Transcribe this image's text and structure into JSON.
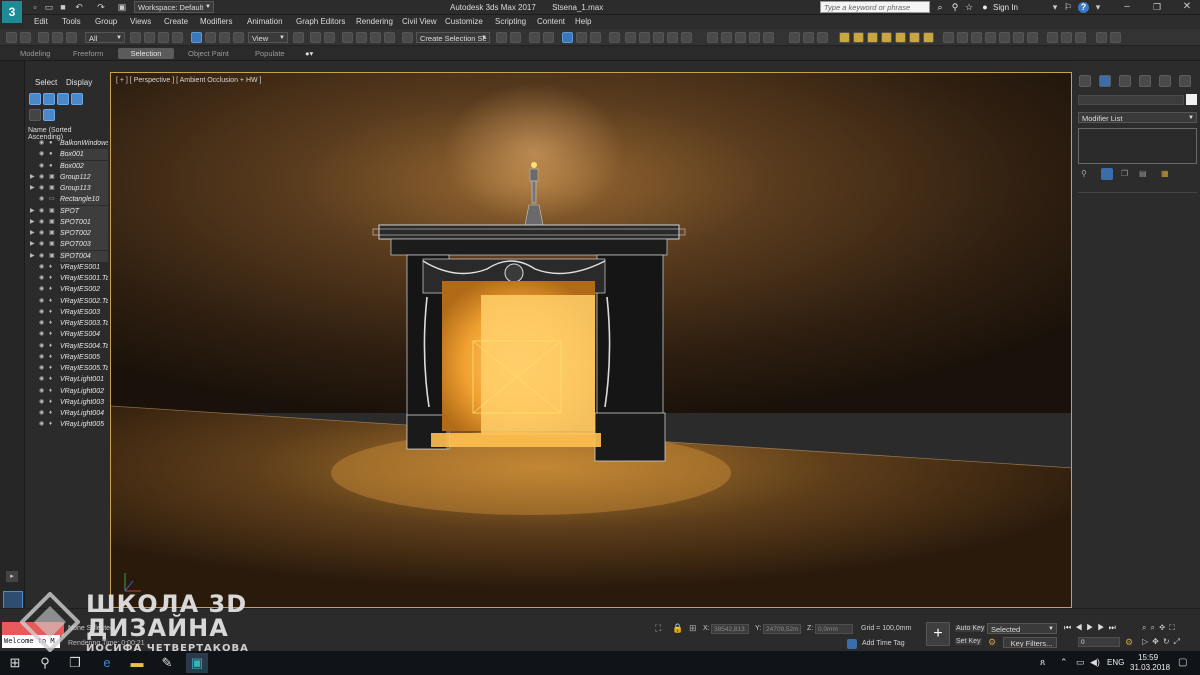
{
  "window": {
    "logo_text": "3",
    "title": "Autodesk 3ds Max 2017",
    "file": "Stsena_1.max",
    "workspace_label": "Workspace: Default",
    "search_placeholder": "Type a keyword or phrase",
    "sign_in": "Sign In",
    "help_icon": "?"
  },
  "menu": [
    "Edit",
    "Tools",
    "Group",
    "Views",
    "Create",
    "Modifiers",
    "Animation",
    "Graph Editors",
    "Rendering",
    "Civil View",
    "Customize",
    "Scripting",
    "Content",
    "Help"
  ],
  "toolbar": {
    "filter_value": "All",
    "refcoord_value": "View",
    "selection_set_value": "Create Selection Se"
  },
  "ribbon": {
    "tabs": [
      "Modeling",
      "Freeform",
      "Selection",
      "Object Paint",
      "Populate"
    ],
    "active_tab": "Selection"
  },
  "scene_explorer": {
    "tabs": [
      "Select",
      "Display"
    ],
    "column_header": "Name (Sorted Ascending)",
    "items": [
      {
        "name": "BalkonWindows",
        "expand": false,
        "icon": "sphere"
      },
      {
        "name": "Box001",
        "expand": false,
        "icon": "sphere",
        "highlight": true
      },
      {
        "name": "Box002",
        "expand": false,
        "icon": "sphere",
        "highlight": true
      },
      {
        "name": "Group112",
        "expand": true,
        "icon": "group",
        "highlight": true
      },
      {
        "name": "Group113",
        "expand": true,
        "icon": "group",
        "highlight": true
      },
      {
        "name": "Rectangle10",
        "expand": false,
        "icon": "shape",
        "highlight": true
      },
      {
        "name": "SPOT",
        "expand": true,
        "icon": "group",
        "highlight": true
      },
      {
        "name": "SPOT001",
        "expand": true,
        "icon": "group",
        "highlight": true
      },
      {
        "name": "SPOT002",
        "expand": true,
        "icon": "group",
        "highlight": true
      },
      {
        "name": "SPOT003",
        "expand": true,
        "icon": "group",
        "highlight": true
      },
      {
        "name": "SPOT004",
        "expand": true,
        "icon": "group",
        "highlight": true
      },
      {
        "name": "VRayIES001",
        "expand": false,
        "icon": "light"
      },
      {
        "name": "VRayIES001.Ta",
        "expand": false,
        "icon": "light"
      },
      {
        "name": "VRayIES002",
        "expand": false,
        "icon": "light"
      },
      {
        "name": "VRayIES002.Ta",
        "expand": false,
        "icon": "light"
      },
      {
        "name": "VRayIES003",
        "expand": false,
        "icon": "light"
      },
      {
        "name": "VRayIES003.Ta",
        "expand": false,
        "icon": "light"
      },
      {
        "name": "VRayIES004",
        "expand": false,
        "icon": "light"
      },
      {
        "name": "VRayIES004.Ta",
        "expand": false,
        "icon": "light"
      },
      {
        "name": "VRayIES005",
        "expand": false,
        "icon": "light"
      },
      {
        "name": "VRayIES005.Ta",
        "expand": false,
        "icon": "light"
      },
      {
        "name": "VRayLight001",
        "expand": false,
        "icon": "light"
      },
      {
        "name": "VRayLight002",
        "expand": false,
        "icon": "light"
      },
      {
        "name": "VRayLight003",
        "expand": false,
        "icon": "light"
      },
      {
        "name": "VRayLight004",
        "expand": false,
        "icon": "light"
      },
      {
        "name": "VRayLight005",
        "expand": false,
        "icon": "light"
      }
    ]
  },
  "viewport": {
    "label": "[ + ] [ Perspective ] [ Ambient Occlusion + HW ]",
    "frame_color": "#c8a14a"
  },
  "command_panel": {
    "modifier_list": "Modifier List"
  },
  "status": {
    "none_selected": "None Selected",
    "rendering_time": "Rendering Time: 0:00:21",
    "welcome": "Welcome to M",
    "x_label": "X:",
    "x_value": "38542,813",
    "y_label": "Y:",
    "y_value": "24709,52m",
    "z_label": "Z:",
    "z_value": "0,0mm",
    "grid": "Grid = 100,0mm",
    "add_time_tag": "Add Time Tag",
    "auto_key": "Auto Key",
    "set_key": "Set Key",
    "selected_value": "Selected",
    "key_filters": "Key Filters...",
    "frame_value": "0"
  },
  "watermark": {
    "line1": "ШКОЛА 3D",
    "line2": "ДИЗАЙНА",
    "line3": "ИОСИФА ЧЕТВЕРТАКОВА"
  },
  "taskbar": {
    "lang": "ENG",
    "time": "15:59",
    "date": "31.03.2018"
  }
}
